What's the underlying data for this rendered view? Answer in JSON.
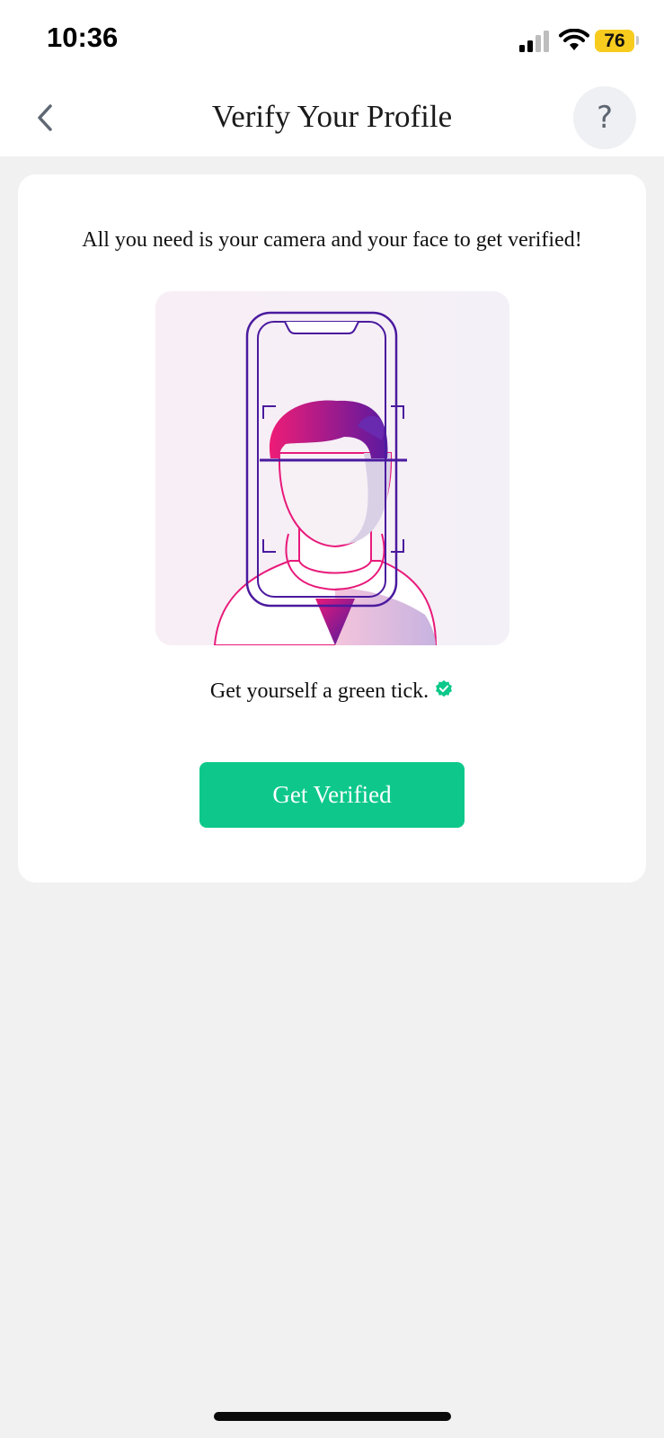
{
  "status_bar": {
    "time": "10:36",
    "battery_level": "76",
    "battery_color": "#f7cc1f",
    "icons": [
      "signal-icon",
      "wifi-icon",
      "battery-icon"
    ]
  },
  "header": {
    "title": "Verify Your Profile",
    "back_icon": "chevron-left-icon",
    "help_label": "?"
  },
  "card": {
    "intro": "All you need is your camera and your face to get verified!",
    "illustration": "face-scan-illustration",
    "tick_text": "Get yourself a green tick.",
    "tick_icon": "verified-badge-icon",
    "button_label": "Get Verified"
  },
  "colors": {
    "accent": "#0dc88a",
    "illustration_magenta": "#e8197a",
    "illustration_purple": "#4a1a9e",
    "page_background": "#f1f1f1"
  }
}
